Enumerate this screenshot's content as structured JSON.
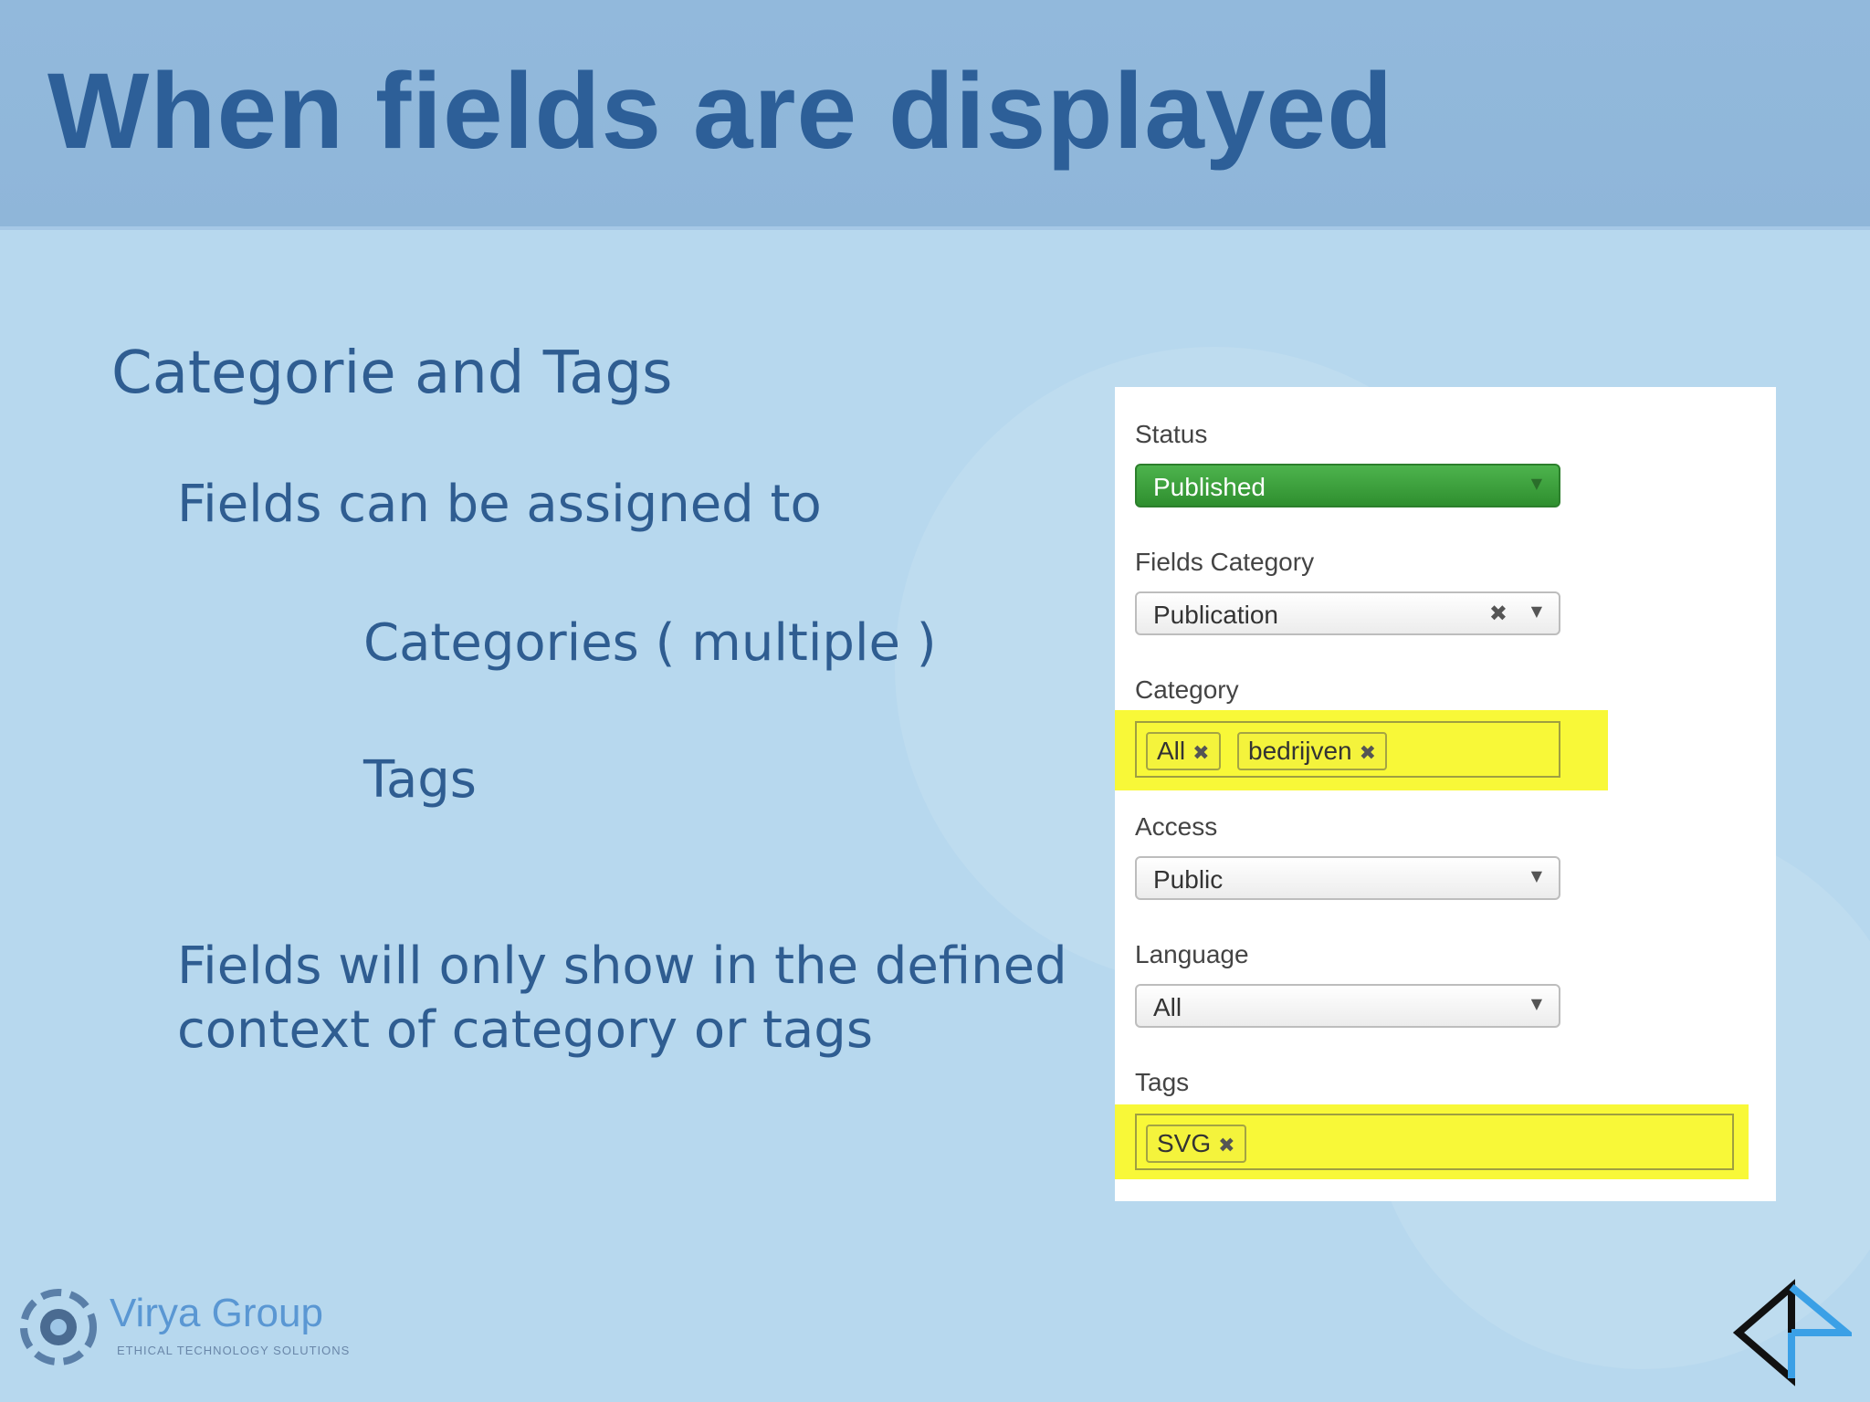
{
  "slide": {
    "title": "When fields are displayed",
    "heading": "Categorie and Tags",
    "line1": "Fields can be assigned to",
    "line2": "Categories ( multiple )",
    "line3": "Tags",
    "line4": "Fields will only show in the defined context of category or tags"
  },
  "form": {
    "status": {
      "label": "Status",
      "value": "Published"
    },
    "fields_category": {
      "label": "Fields Category",
      "value": "Publication"
    },
    "category": {
      "label": "Category",
      "chips": [
        "All",
        "bedrijven"
      ]
    },
    "access": {
      "label": "Access",
      "value": "Public"
    },
    "language": {
      "label": "Language",
      "value": "All"
    },
    "tags": {
      "label": "Tags",
      "chips": [
        "SVG"
      ]
    }
  },
  "branding": {
    "name": "Virya Group",
    "tagline": "ETHICAL TECHNOLOGY SOLUTIONS"
  },
  "icons": {
    "dropdown": "chevron-down-icon",
    "remove": "close-icon",
    "logo": "virya-logo-icon",
    "corner": "corner-logo-icon"
  },
  "colors": {
    "header_bg": "#92b9dc",
    "slide_bg": "#b7d8ee",
    "title_text": "#2d5f98",
    "status_green": "#3a9f3a",
    "highlight_yellow": "#f8f838"
  }
}
